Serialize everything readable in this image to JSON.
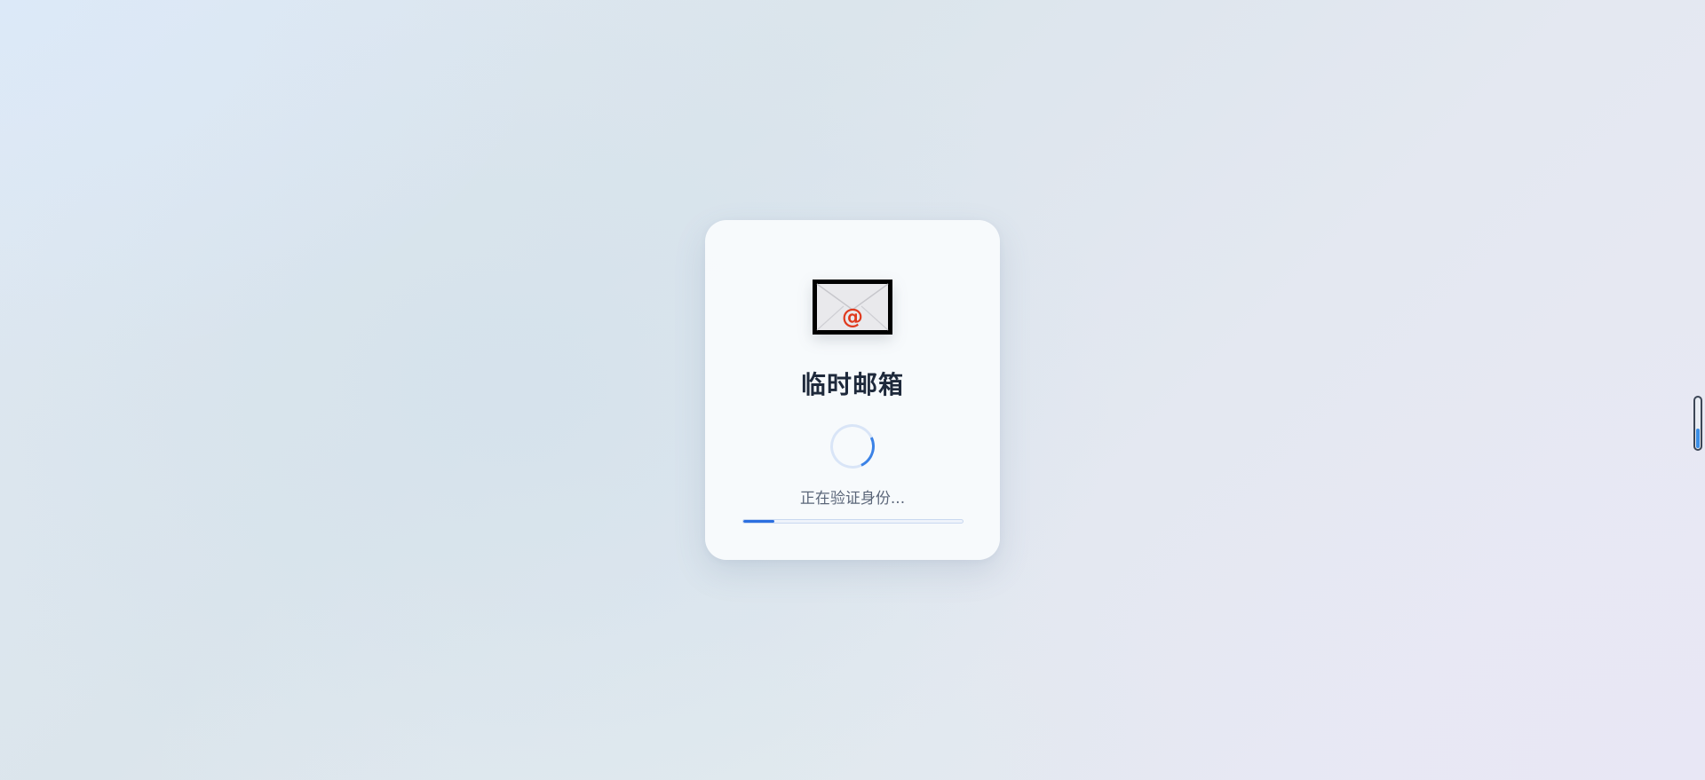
{
  "app": {
    "title": "临时邮箱",
    "logo_icon": "envelope-at-icon",
    "logo_at_symbol": "@"
  },
  "loading": {
    "status_text": "正在验证身份...",
    "progress_percent": 14,
    "spinner_icon": "spinner-icon"
  },
  "side_indicator": {
    "fill_fraction": 0.4
  },
  "colors": {
    "accent": "#2c6fe0",
    "title": "#1e293b",
    "status_text": "#5b6679",
    "logo_at": "#e03a1e"
  }
}
